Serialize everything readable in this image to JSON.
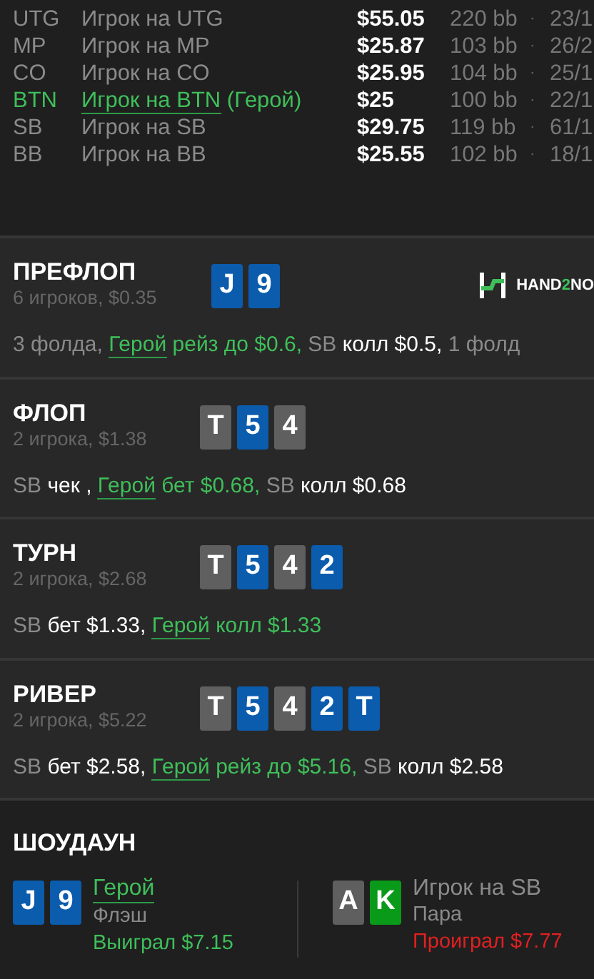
{
  "players": [
    {
      "position": "UTG",
      "name": "Игрок на UTG",
      "hero": false,
      "stack": "$55.05",
      "bb": "220 bb",
      "separator": "·",
      "stat": "23/1"
    },
    {
      "position": "MP",
      "name": "Игрок на MP",
      "hero": false,
      "stack": "$25.87",
      "bb": "103 bb",
      "separator": "·",
      "stat": "26/2"
    },
    {
      "position": "CO",
      "name": "Игрок на CO",
      "hero": false,
      "stack": "$25.95",
      "bb": "104 bb",
      "separator": "·",
      "stat": "25/1"
    },
    {
      "position": "BTN",
      "name": "Игрок на BTN",
      "hero": true,
      "hero_tag": "(Герой)",
      "stack": "$25",
      "bb": "100 bb",
      "separator": "·",
      "stat": "22/1"
    },
    {
      "position": "SB",
      "name": "Игрок на SB",
      "hero": false,
      "stack": "$29.75",
      "bb": "119 bb",
      "separator": "·",
      "stat": "61/1"
    },
    {
      "position": "BB",
      "name": "Игрок на BB",
      "hero": false,
      "stack": "$25.55",
      "bb": "102 bb",
      "separator": "·",
      "stat": "18/1"
    }
  ],
  "logo": {
    "parts": [
      "HAND",
      "2",
      "NO"
    ]
  },
  "streets": [
    {
      "title": "ПРЕФЛОП",
      "subtitle": "6 игроков, $0.35",
      "cards": [
        {
          "rank": "J",
          "color": "#0b5cad"
        },
        {
          "rank": "9",
          "color": "#0b5cad"
        }
      ],
      "actions": [
        {
          "kind": "plain",
          "text": "3 фолда,"
        },
        {
          "kind": "hero",
          "actor": "Герой",
          "text": "рейз до $0.6,"
        },
        {
          "kind": "villain",
          "actor": "SB",
          "text": "колл $0.5,"
        },
        {
          "kind": "plain",
          "text": "1 фолд"
        }
      ]
    },
    {
      "title": "ФЛОП",
      "subtitle": "2 игрока, $1.38",
      "cards": [
        {
          "rank": "T",
          "color": "#5f5f5f"
        },
        {
          "rank": "5",
          "color": "#0b5cad"
        },
        {
          "rank": "4",
          "color": "#5f5f5f"
        }
      ],
      "actions": [
        {
          "kind": "villain",
          "actor": "SB",
          "text": "чек ,"
        },
        {
          "kind": "hero",
          "actor": "Герой",
          "text": "бет $0.68,"
        },
        {
          "kind": "villain",
          "actor": "SB",
          "text": "колл $0.68"
        }
      ]
    },
    {
      "title": "ТУРН",
      "subtitle": "2 игрока, $2.68",
      "cards": [
        {
          "rank": "T",
          "color": "#5f5f5f"
        },
        {
          "rank": "5",
          "color": "#0b5cad"
        },
        {
          "rank": "4",
          "color": "#5f5f5f"
        },
        {
          "rank": "2",
          "color": "#0b5cad"
        }
      ],
      "actions": [
        {
          "kind": "villain",
          "actor": "SB",
          "text": "бет $1.33,"
        },
        {
          "kind": "hero",
          "actor": "Герой",
          "text": "колл $1.33"
        }
      ]
    },
    {
      "title": "РИВЕР",
      "subtitle": "2 игрока, $5.22",
      "cards": [
        {
          "rank": "T",
          "color": "#5f5f5f"
        },
        {
          "rank": "5",
          "color": "#0b5cad"
        },
        {
          "rank": "4",
          "color": "#5f5f5f"
        },
        {
          "rank": "2",
          "color": "#0b5cad"
        },
        {
          "rank": "T",
          "color": "#0b5cad"
        }
      ],
      "actions": [
        {
          "kind": "villain",
          "actor": "SB",
          "text": "бет $2.58,"
        },
        {
          "kind": "hero",
          "actor": "Герой",
          "text": "рейз до $5.16,"
        },
        {
          "kind": "villain",
          "actor": "SB",
          "text": "колл $2.58"
        }
      ]
    }
  ],
  "showdown": {
    "title": "ШОУДАУН",
    "hands": [
      {
        "hero": true,
        "player": "Герой",
        "cards": [
          {
            "rank": "J",
            "color": "#0b5cad"
          },
          {
            "rank": "9",
            "color": "#0b5cad"
          }
        ],
        "combo": "Флэш",
        "won": true,
        "result": "Выиграл $7.15"
      },
      {
        "hero": false,
        "player": "Игрок на SB",
        "cards": [
          {
            "rank": "A",
            "color": "#5f5f5f"
          },
          {
            "rank": "K",
            "color": "#0a9a1a"
          }
        ],
        "combo": "Пара",
        "won": false,
        "result": "Проиграл $7.77"
      }
    ]
  }
}
